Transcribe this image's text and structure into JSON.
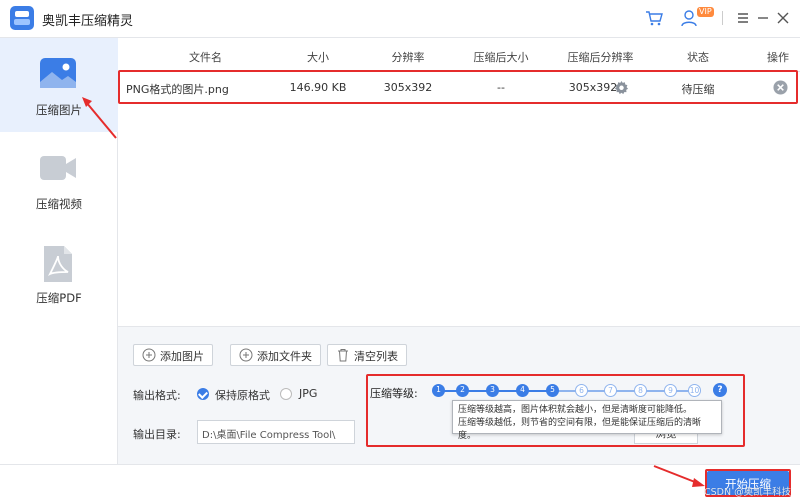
{
  "window": {
    "title": "奥凯丰压缩精灵",
    "vip_badge": "VIP",
    "icons": [
      "cart-icon",
      "user-icon",
      "menu-icon",
      "minimize-icon",
      "close-icon"
    ]
  },
  "sidebar": {
    "items": [
      {
        "label": "压缩图片",
        "icon": "image-icon",
        "active": true
      },
      {
        "label": "压缩视频",
        "icon": "video-icon",
        "active": false
      },
      {
        "label": "压缩PDF",
        "icon": "pdf-icon",
        "active": false
      }
    ]
  },
  "table": {
    "headers": [
      "文件名",
      "大小",
      "分辨率",
      "压缩后大小",
      "压缩后分辨率",
      "状态",
      "操作"
    ],
    "rows": [
      {
        "filename": "PNG格式的图片.png",
        "size": "146.90 KB",
        "resolution": "305x392",
        "compressed_size": "--",
        "compressed_resolution": "305x392",
        "status": "待压缩"
      }
    ]
  },
  "actions": {
    "add_image": "添加图片",
    "add_folder": "添加文件夹",
    "clear_list": "清空列表"
  },
  "output": {
    "format_label": "输出格式:",
    "format_options": [
      "保持原格式",
      "JPG"
    ],
    "format_selected": "保持原格式",
    "dir_label": "输出目录:",
    "dir_value": "D:\\桌面\\File Compress Tool\\",
    "browse_label": "浏览"
  },
  "compression": {
    "level_label": "压缩等级:",
    "levels": [
      "1",
      "2",
      "3",
      "4",
      "5",
      "6",
      "7",
      "8",
      "9",
      "10"
    ],
    "selected_level": 5,
    "help_icon_text": "?",
    "tooltip_line1": "压缩等级越高，图片体积就会越小，但是清晰度可能降低。",
    "tooltip_line2": "压缩等级越低，则节省的空间有限，但是能保证压缩后的清晰度。"
  },
  "footer": {
    "start_label": "开始压缩",
    "watermark": "CSDN @奥凯丰科技"
  },
  "colors": {
    "accent": "#3b7de6",
    "highlight": "#e52c2c",
    "active_bg": "#e8f0fd"
  }
}
